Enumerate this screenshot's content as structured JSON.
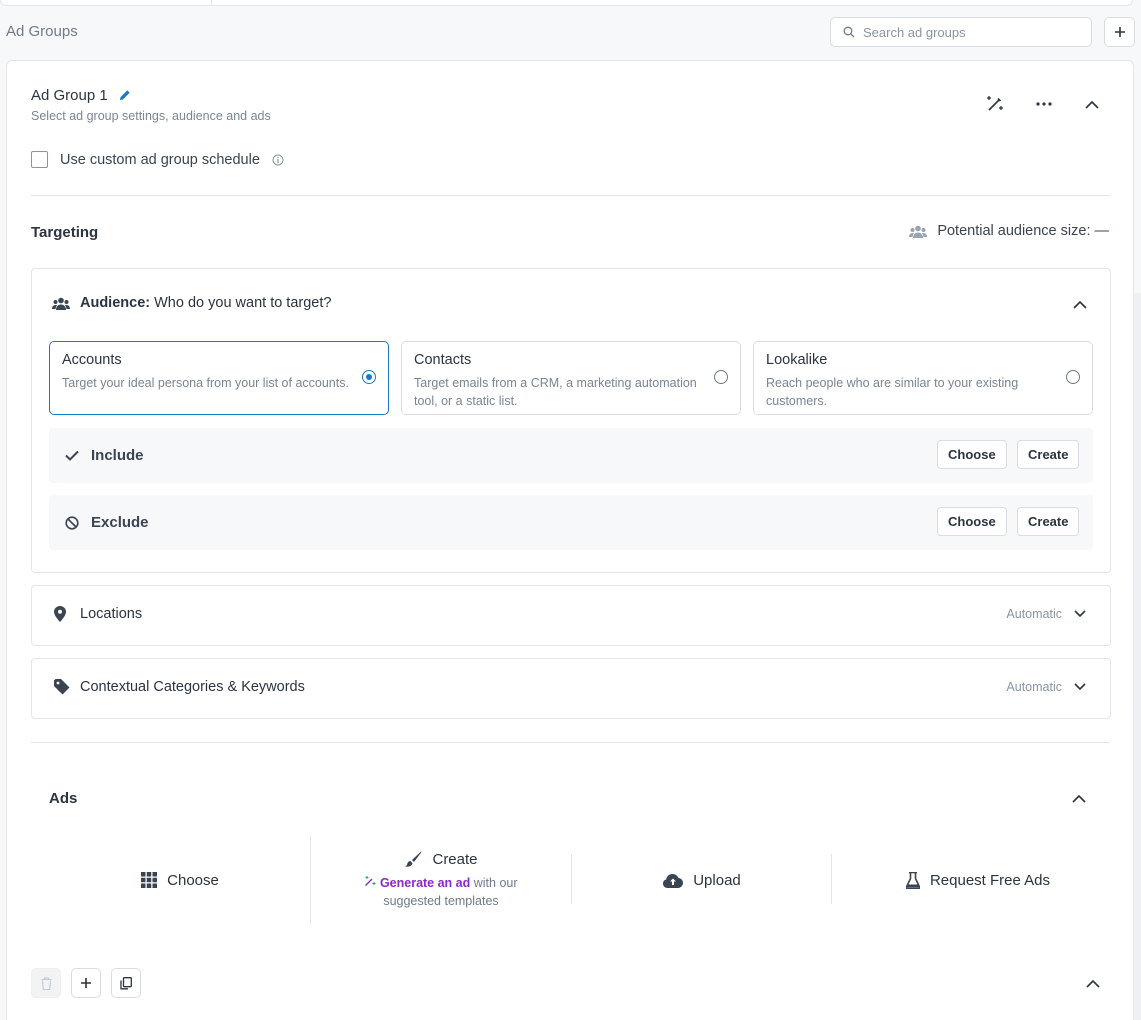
{
  "page": {
    "heading": "Ad Groups",
    "search_placeholder": "Search ad groups"
  },
  "ad_group": {
    "title": "Ad Group 1",
    "subtitle": "Select ad group settings, audience and ads",
    "custom_schedule_label": "Use custom ad group schedule",
    "custom_schedule_checked": false
  },
  "targeting": {
    "title": "Targeting",
    "audience_size_label": "Potential audience size: —",
    "audience": {
      "label_bold": "Audience:",
      "label_rest": "Who do you want to target?",
      "options": [
        {
          "title": "Accounts",
          "desc": "Target your ideal persona from your list of accounts.",
          "selected": true
        },
        {
          "title": "Contacts",
          "desc": "Target emails from a CRM, a marketing automation tool, or a static list.",
          "selected": false
        },
        {
          "title": "Lookalike",
          "desc": "Reach people who are similar to your existing customers.",
          "selected": false
        }
      ],
      "include": {
        "label": "Include",
        "choose": "Choose",
        "create": "Create"
      },
      "exclude": {
        "label": "Exclude",
        "choose": "Choose",
        "create": "Create"
      }
    },
    "locations": {
      "label": "Locations",
      "status": "Automatic"
    },
    "contextual": {
      "label": "Contextual Categories & Keywords",
      "status": "Automatic"
    }
  },
  "ads": {
    "title": "Ads",
    "choose": "Choose",
    "create": "Create",
    "generate_link": "Generate an ad",
    "generate_rest": "with our suggested templates",
    "upload": "Upload",
    "request": "Request Free Ads"
  },
  "colors": {
    "accent": "#1a7bc4",
    "generate_link": "#8a28c8"
  }
}
